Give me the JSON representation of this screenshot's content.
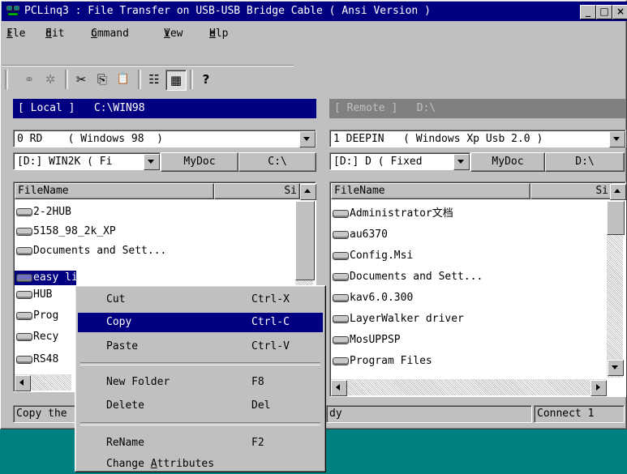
{
  "window": {
    "title": "PCLinq3 : File Transfer on USB-USB Bridge Cable ( Ansi Version )",
    "minimize_glyph": "_",
    "maximize_glyph": "□",
    "close_glyph": "×"
  },
  "menubar": {
    "items": [
      {
        "label": "File",
        "mnemonic": "F",
        "rest": "ile"
      },
      {
        "label": "Edit",
        "mnemonic": "E",
        "rest": "dit"
      },
      {
        "label": "Command",
        "mnemonic": "C",
        "rest": "ommand"
      },
      {
        "label": "View",
        "mnemonic": "V",
        "rest": "iew"
      },
      {
        "label": "Help",
        "mnemonic": "H",
        "rest": "elp"
      }
    ]
  },
  "toolbar": {
    "icons": [
      "connect-icon",
      "disconnect-icon",
      "cut-icon",
      "copy-icon",
      "paste-icon",
      "list-view-icon",
      "detail-view-icon",
      "help-icon"
    ],
    "glyphs": [
      "⚭",
      "✲",
      "✂",
      "⎘",
      "📋",
      "☷",
      "▦",
      "?"
    ]
  },
  "local": {
    "header": "[ Local ]   C:\\WIN98",
    "computer": "0 RD    ( Windows 98  )",
    "drive": "[D:] WIN2K ( Fi",
    "mydoc": "MyDoc",
    "root": "C:\\",
    "col_filename": "FileName",
    "col_size": "Si",
    "files": [
      "2-2HUB",
      "5158_98_2k_XP",
      "Documents and Sett...",
      "easy link",
      "HUB",
      "Prog",
      "Recy",
      "RS48"
    ],
    "status": "Copy the"
  },
  "remote": {
    "header": "[ Remote ]   D:\\",
    "computer": "1 DEEPIN   ( Windows Xp Usb 2.0 )",
    "drive": "[D:] D ( Fixed",
    "mydoc": "MyDoc",
    "root": "D:\\",
    "col_filename": "FileName",
    "col_size": "Si",
    "files": [
      "Administrator文档",
      "au6370",
      "Config.Msi",
      "Documents and Sett...",
      "kav6.0.300",
      "LayerWalker driver",
      "MosUPPSP",
      "Program Files"
    ],
    "status": "dy",
    "connect": "Connect 1"
  },
  "context_menu": {
    "items": [
      {
        "label": "Cut",
        "shortcut": "Ctrl-X"
      },
      {
        "label": "Copy",
        "shortcut": "Ctrl-C"
      },
      {
        "label": "Paste",
        "shortcut": "Ctrl-V"
      },
      {
        "label": "New Folder",
        "shortcut": "F8"
      },
      {
        "label": "Delete",
        "shortcut": "Del"
      },
      {
        "label": "ReName",
        "shortcut": "F2"
      },
      {
        "label": "Change Attributes",
        "shortcut": "",
        "mnemonic_prefix": "Change ",
        "mnemonic": "A",
        "rest": "ttributes"
      }
    ]
  },
  "colors": {
    "active_title": "#000080",
    "inactive_title": "#808080",
    "face": "#c0c0c0",
    "desktop": "#008080"
  }
}
